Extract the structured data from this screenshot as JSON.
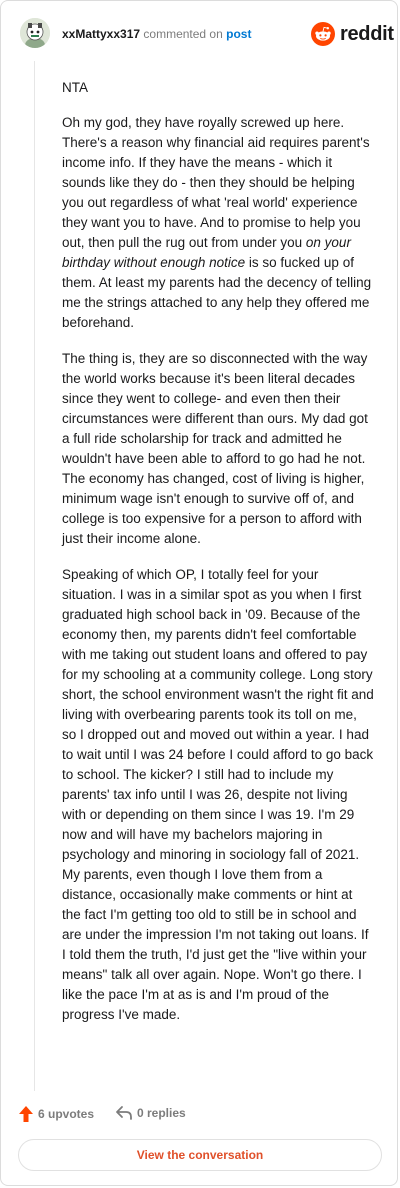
{
  "comment": {
    "username": "xxMattyxx317",
    "meta_text": "commented on",
    "post_link": "post",
    "paragraphs": {
      "p1": "NTA",
      "p2_before": "Oh my god, they have royally screwed up here. There's a reason why financial aid requires parent's income info. If they have the means - which it sounds like they do - then they should be helping you out regardless of what 'real world' experience they want you to have. And to promise to help you out, then pull the rug out from under you ",
      "p2_italic": "on your birthday without enough notice",
      "p2_after": " is so fucked up of them. At least my parents had the decency of telling me the strings attached to any help they offered me beforehand.",
      "p3": "The thing is, they are so disconnected with the way the world works because it's been literal decades since they went to college- and even then their circumstances were different than ours. My dad got a full ride scholarship for track and admitted he wouldn't have been able to afford to go had he not. The economy has changed, cost of living is higher, minimum wage isn't enough to survive off of, and college is too expensive for a person to afford with just their income alone.",
      "p4": "Speaking of which OP, I totally feel for your situation. I was in a similar spot as you when I first graduated high school back in '09. Because of the economy then, my parents didn't feel comfortable with me taking out student loans and offered to pay for my schooling at a community college. Long story short, the school environment wasn't the right fit and living with overbearing parents took its toll on me, so I dropped out and moved out within a year. I had to wait until I was 24 before I could afford to go back to school. The kicker? I still had to include my parents' tax info until I was 26, despite not living with or depending on them since I was 19. I'm 29 now and will have my bachelors majoring in psychology and minoring in sociology fall of 2021. My parents, even though I love them from a distance, occasionally make comments or hint at the fact I'm getting too old to still be in school and are under the impression I'm not taking out loans. If I told them the truth, I'd just get the \"live within your means\" talk all over again. Nope. Won't go there. I like the pace I'm at as is and I'm proud of the progress I've made."
    }
  },
  "brand": {
    "name": "reddit",
    "color": "#ff4500"
  },
  "footer": {
    "upvotes": "6 upvotes",
    "replies": "0 replies",
    "upvote_color": "#ff4500"
  },
  "cta": {
    "label": "View the conversation",
    "color": "#e0502a"
  },
  "icons": {
    "avatar": "avatar",
    "brand": "reddit-logo-icon",
    "upvote": "upvote-arrow-icon",
    "reply": "reply-arrow-icon"
  }
}
